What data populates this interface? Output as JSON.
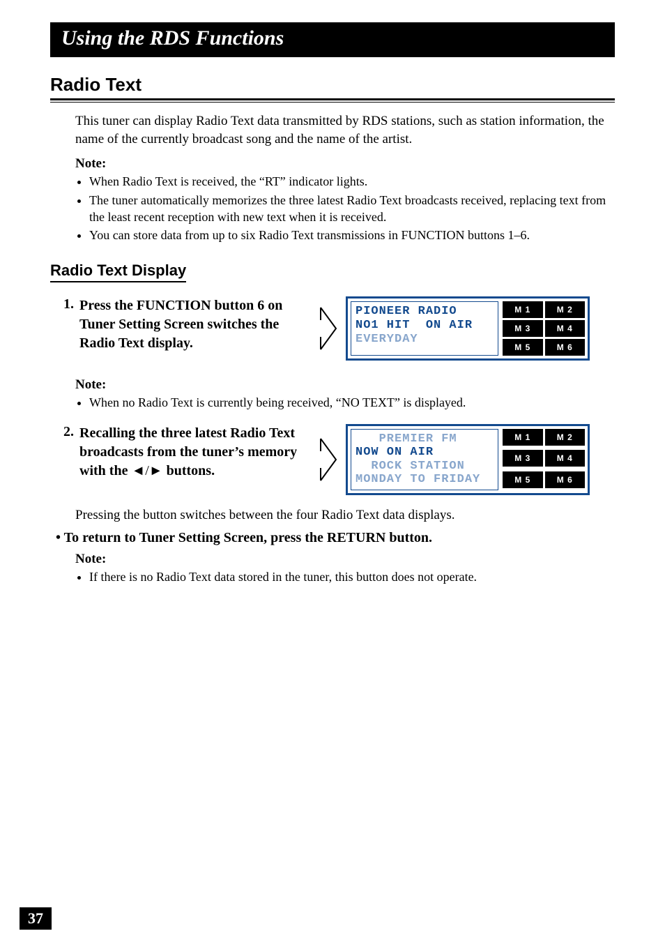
{
  "page_number": "37",
  "banner": "Using the RDS Functions",
  "section": {
    "title": "Radio Text",
    "intro": "This tuner can display Radio Text data transmitted by RDS stations, such as station information, the name of the currently broadcast song and the name of the artist.",
    "note_label": "Note:",
    "notes": [
      "When Radio Text is received, the “RT” indicator lights.",
      "The tuner automatically memorizes the three latest Radio Text broadcasts received, replacing text from the least recent reception with new text when it is received.",
      "You can store data from up to six Radio Text transmissions in FUNCTION buttons 1–6."
    ]
  },
  "subsection": {
    "title": "Radio Text Display",
    "steps": [
      {
        "num": "1.",
        "text": "Press the FUNCTION button 6 on Tuner Setting Screen switches the Radio Text display."
      },
      {
        "num": "2.",
        "text_prefix": "Recalling the three latest Radio Text broadcasts from the tuner’s memory with the ",
        "text_suffix": " buttons.",
        "arrows": "◄/►"
      }
    ],
    "step1_note_label": "Note:",
    "step1_notes": [
      "When no Radio Text is currently being received, “NO TEXT” is displayed."
    ],
    "after_step2": "Pressing the button switches between the four Radio Text data displays.",
    "return_bullet": "To return to Tuner Setting Screen, press the RETURN button.",
    "final_note_label": "Note:",
    "final_notes": [
      "If there is no Radio Text data stored in the tuner, this button does not operate."
    ]
  },
  "displays": {
    "panel1_line1": "PIONEER RADIO",
    "panel1_line2": "NO1 HIT  ON AIR",
    "panel1_line3": "EVERYDAY",
    "panel2_line1": "   PREMIER FM",
    "panel2_line2": "NOW ON AIR",
    "panel2_line3": "  ROCK STATION",
    "panel2_line4": "MONDAY TO FRIDAY",
    "m_labels": [
      "M 1",
      "M 2",
      "M 3",
      "M 4",
      "M 5",
      "M 6"
    ]
  }
}
